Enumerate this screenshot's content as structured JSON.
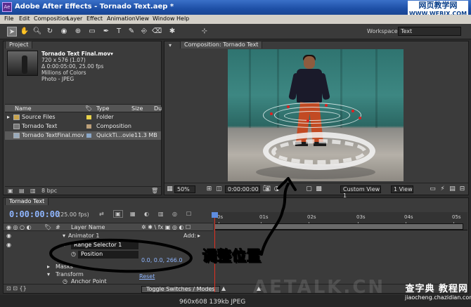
{
  "window": {
    "title": "Adobe After Effects - Tornado Text.aep *",
    "app_icon_text": "Ae"
  },
  "watermark_top": {
    "line1": "网页教学网",
    "line2": "WWW.WEBJX.COM"
  },
  "menu": [
    "File",
    "Edit",
    "Composition",
    "Layer",
    "Effect",
    "Animation",
    "View",
    "Window",
    "Help"
  ],
  "toolbar": {
    "tools": [
      "selection-tool-icon",
      "hand-tool-icon",
      "zoom-tool-icon",
      "rotation-tool-icon",
      "orbit-camera-icon",
      "pan-behind-icon",
      "mask-tool-icon",
      "pen-tool-icon",
      "type-tool-icon",
      "brush-tool-icon",
      "clone-stamp-icon",
      "eraser-tool-icon",
      "puppet-pin-icon",
      "axis-mode-icon"
    ],
    "workspace_label": "Workspace:",
    "workspace_value": "Text"
  },
  "project": {
    "tab_label": "Project",
    "selected_item": {
      "name": "Tornado Text Final.mov▾",
      "dimensions": "720 x 576 (1.07)",
      "duration": "Δ 0:00:05:00, 25.00 fps",
      "colors": "Millions of Colors",
      "codec": "Photo - JPEG"
    },
    "columns": {
      "name": "Name",
      "type": "Type",
      "size": "Size",
      "du": "Du"
    },
    "items": [
      {
        "name": "Source Files",
        "type": "Folder",
        "size": "",
        "color": "#e8d24a"
      },
      {
        "name": "Tornado Text",
        "type": "Composition",
        "size": "",
        "color": "#bca07a"
      },
      {
        "name": "Tornado TextFinal.mov",
        "type": "QuickTi...ovie",
        "size": "11.3 MB",
        "color": "#8aa7c8"
      }
    ],
    "footer_bpc": "8 bpc"
  },
  "composition": {
    "tab_label": "Composition: Tornado Text",
    "zoom": "50%",
    "timecode": "0:00:00:00",
    "view_label": "Custom View 1",
    "view_count": "1 View"
  },
  "timeline": {
    "tab_label": "Tornado Text",
    "current_time": "0:00:00:00",
    "fps": "(25.00 fps)",
    "col_hash": "#",
    "col_layer_name": "Layer Name",
    "ruler_labels": [
      "0s",
      "01s",
      "02s",
      "03s",
      "04s",
      "05s"
    ],
    "rows": {
      "animator": "Animator 1",
      "add_label": "Add:",
      "range_selector": "Range Selector 1",
      "position": "Position",
      "position_value": "0.0, 0.0, 266.0",
      "masks": "Masks",
      "transform": "Transform",
      "reset": "Reset",
      "anchor_point": "Anchor Point"
    },
    "toggle_label": "Toggle Switches / Modes"
  },
  "annotation": {
    "text": "调整位置"
  },
  "image_info": "960x608  139kb  JPEG",
  "watermark_bottom": {
    "line1": "查字典 教程网",
    "line2": "jiaocheng.chazidian.com"
  },
  "watermark_faint": "AETALK.CN"
}
